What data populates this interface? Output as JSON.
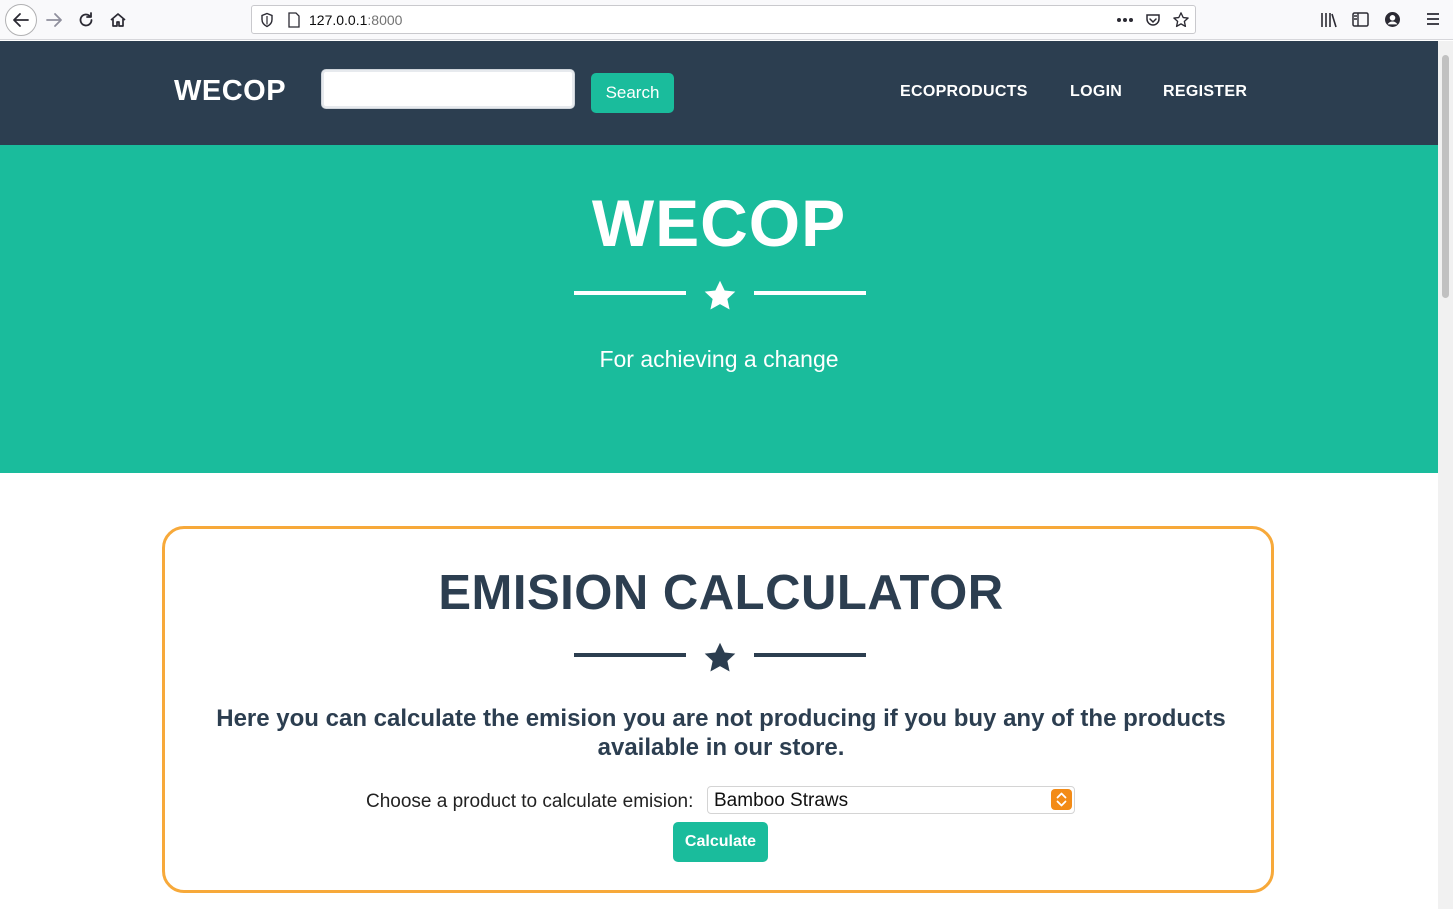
{
  "browser": {
    "url_host": "127.0.0.1",
    "url_port": ":8000"
  },
  "navbar": {
    "brand": "WECOP",
    "search_button": "Search",
    "links": [
      "ECOPRODUCTS",
      "LOGIN",
      "REGISTER"
    ]
  },
  "hero": {
    "title": "WECOP",
    "subtitle": "For achieving a change"
  },
  "calculator": {
    "title": "EMISION CALCULATOR",
    "description": "Here you can calculate the emision you are not producing if you buy any of the products available in our store.",
    "choose_label": "Choose a product to calculate emision:",
    "selected_product": "Bamboo Straws",
    "calculate_button": "Calculate"
  },
  "colors": {
    "navbar": "#2c3e50",
    "accent": "#1abc9c",
    "box_border": "#f7a93a"
  },
  "icons": [
    "back-icon",
    "forward-icon",
    "reload-icon",
    "home-icon",
    "shield-icon",
    "page-icon",
    "more-icon",
    "pocket-icon",
    "bookmark-star-icon",
    "library-icon",
    "sidebar-icon",
    "account-icon",
    "menu-icon",
    "star-icon"
  ]
}
